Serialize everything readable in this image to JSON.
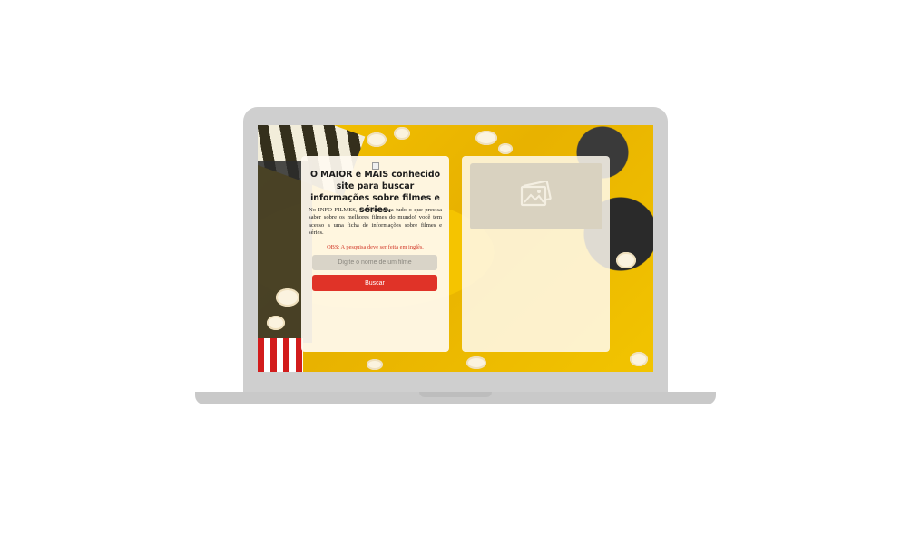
{
  "hero": {
    "title": "O MAIOR e MAIS conhecido site para buscar informações sobre filmes e séries.",
    "description": "No INFO FILMES, você encontra tudo o que precisa saber sobre os melhores filmes do mundo! você tem acesso a uma ficha de informações sobre filmes e séries.",
    "note": "OBS: A pesquisa deve ser feita em inglês."
  },
  "search": {
    "placeholder": "Digite o nome de um filme",
    "value": "",
    "button_label": "Buscar"
  },
  "icons": {
    "logo": "broken-image-icon",
    "poster": "image-placeholder-icon"
  },
  "colors": {
    "button": "#e03328",
    "note": "#d23a2a",
    "panel": "#fffaf0",
    "background": "#f4c200"
  }
}
